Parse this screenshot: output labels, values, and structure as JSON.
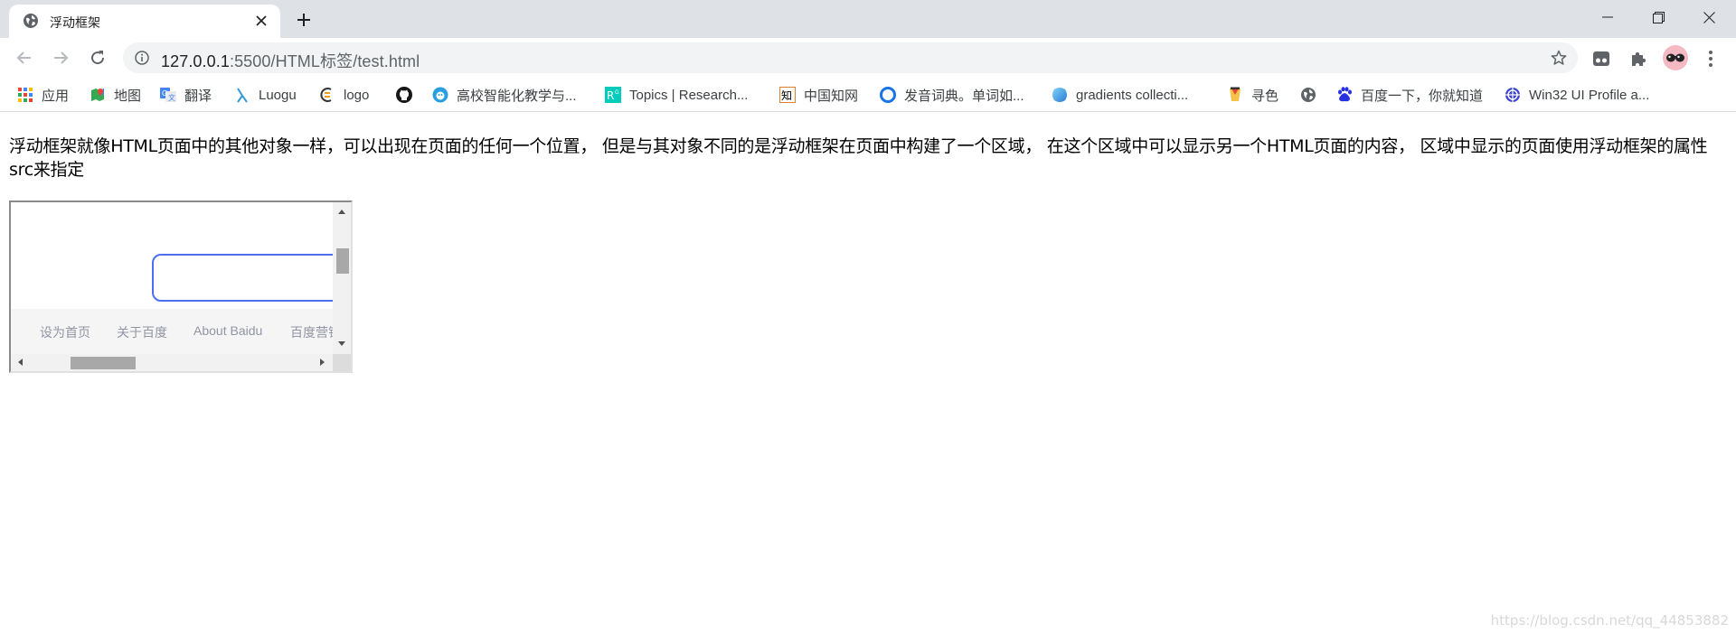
{
  "browser": {
    "tab": {
      "title": "浮动框架",
      "icon": "globe-icon"
    },
    "url": {
      "host": "127.0.0.1",
      "path": ":5500/HTML标签/test.html"
    },
    "bookmarks": [
      {
        "label": "应用",
        "icon": "apps-grid-icon"
      },
      {
        "label": "地图",
        "icon": "maps-icon"
      },
      {
        "label": "翻译",
        "icon": "translate-icon"
      },
      {
        "label": "Luogu",
        "icon": "luogu-icon"
      },
      {
        "label": "logo",
        "icon": "logo-icon"
      },
      {
        "label": "",
        "icon": "github-icon"
      },
      {
        "label": "高校智能化教学与...",
        "icon": "edu-icon"
      },
      {
        "label": "Topics | Research...",
        "icon": "researchgate-icon"
      },
      {
        "label": "中国知网",
        "icon": "cnki-icon"
      },
      {
        "label": "发音词典。单词如...",
        "icon": "pronounce-icon"
      },
      {
        "label": "gradients collecti...",
        "icon": "gradient-icon"
      },
      {
        "label": "寻色",
        "icon": "color-icon"
      },
      {
        "label": "",
        "icon": "globe-icon"
      },
      {
        "label": "百度一下，你就知道",
        "icon": "baidu-paw-icon"
      },
      {
        "label": "Win32 UI Profile a...",
        "icon": "win32-icon"
      }
    ]
  },
  "page": {
    "paragraph": "浮动框架就像HTML页面中的其他对象一样，可以出现在页面的任何一个位置， 但是与其对象不同的是浮动框架在页面中构建了一个区域， 在这个区域中可以显示另一个HTML页面的内容， 区域中显示的页面使用浮动框架的属性src来指定",
    "iframe": {
      "footer_links": [
        "设为首页",
        "关于百度",
        "About Baidu",
        "百度营销"
      ]
    }
  },
  "watermark": "https://blog.csdn.net/qq_44853882",
  "colors": {
    "tabstrip": "#dee1e6",
    "omnibox": "#f1f3f4",
    "baidu_blue": "#4e6ef2"
  }
}
